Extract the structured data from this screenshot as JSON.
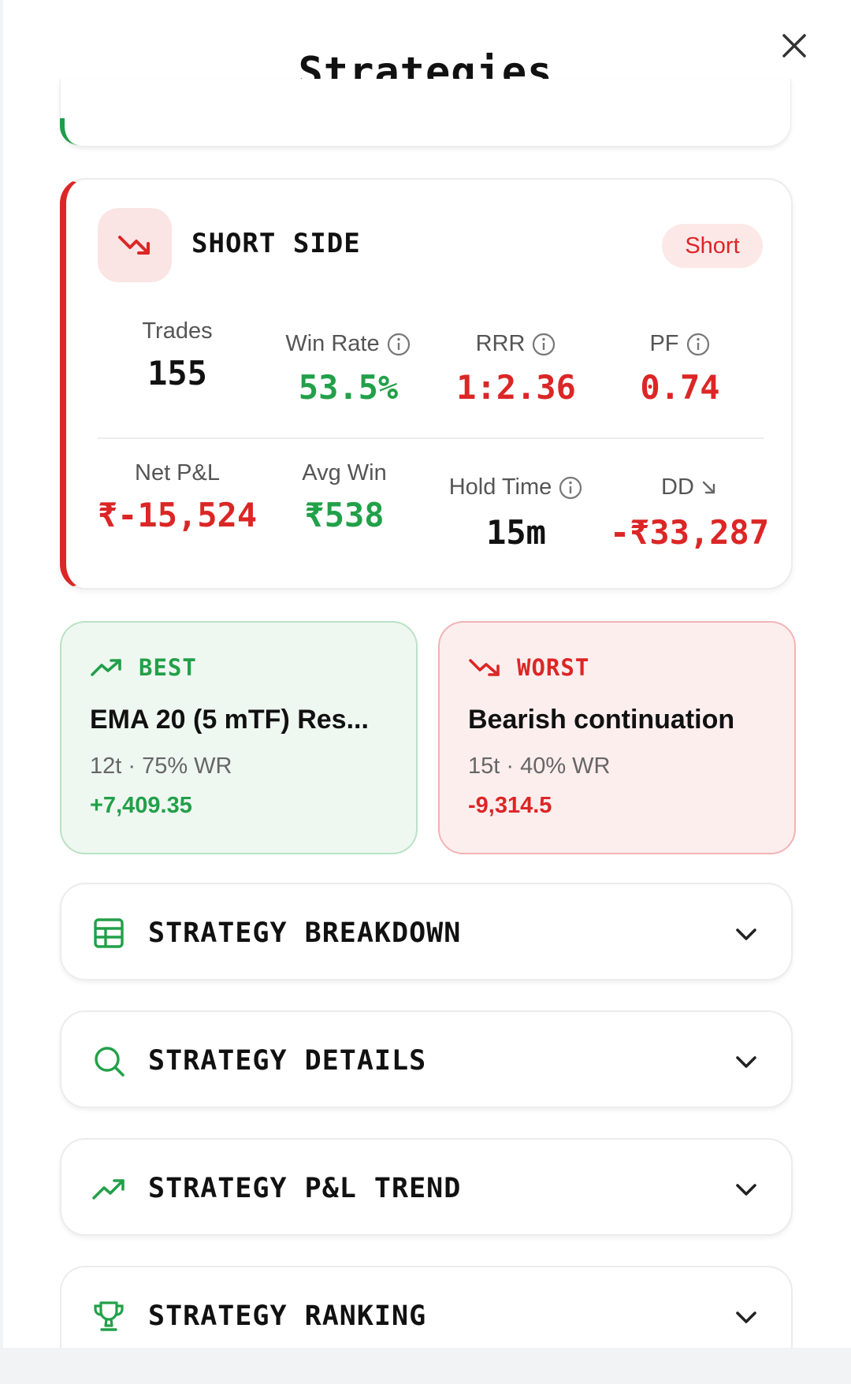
{
  "header": {
    "title": "Strategies"
  },
  "short_side": {
    "title": "SHORT SIDE",
    "badge": "Short",
    "stats_row1": [
      {
        "label": "Trades",
        "value": "155",
        "info": false
      },
      {
        "label": "Win Rate",
        "value": "53.5%",
        "info": true
      },
      {
        "label": "RRR",
        "value": "1:2.36",
        "info": true
      },
      {
        "label": "PF",
        "value": "0.74",
        "info": true
      }
    ],
    "stats_row2": [
      {
        "label": "Net P&L",
        "value": "₹-15,524"
      },
      {
        "label": "Avg Win",
        "value": "₹538"
      },
      {
        "label": "Hold Time",
        "value": "15m"
      },
      {
        "label": "DD",
        "value": "-₹33,287"
      }
    ]
  },
  "best": {
    "heading": "BEST",
    "name": "EMA 20 (5 mTF) Res...",
    "meta": "12t · 75% WR",
    "pnl": "+7,409.35"
  },
  "worst": {
    "heading": "WORST",
    "name": "Bearish continuation",
    "meta": "15t · 40% WR",
    "pnl": "-9,314.5"
  },
  "sections": [
    {
      "label": "STRATEGY BREAKDOWN",
      "icon": "table-icon"
    },
    {
      "label": "STRATEGY DETAILS",
      "icon": "search-icon"
    },
    {
      "label": "STRATEGY P&L TREND",
      "icon": "trending-up-icon"
    },
    {
      "label": "STRATEGY RANKING",
      "icon": "trophy-icon"
    }
  ],
  "colors": {
    "green": "#22a049",
    "red": "#dc2626",
    "badge_bg": "#fde8e8"
  }
}
